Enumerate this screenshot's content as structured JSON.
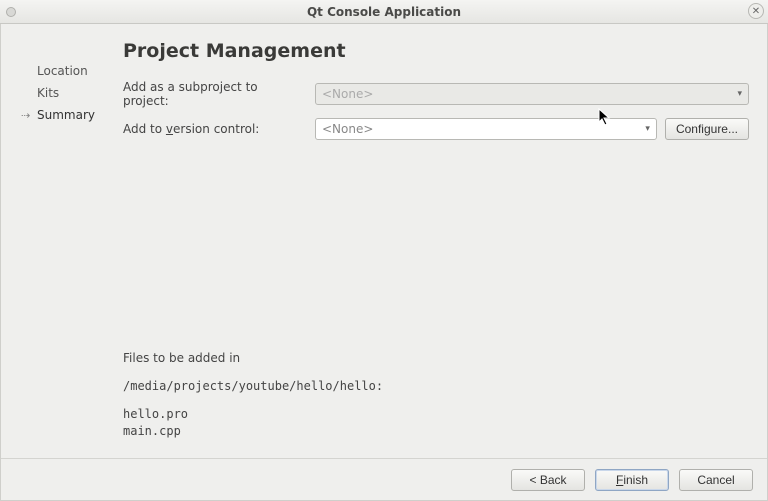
{
  "window": {
    "title": "Qt Console Application"
  },
  "sidebar": {
    "items": [
      {
        "label": "Location",
        "active": false
      },
      {
        "label": "Kits",
        "active": false
      },
      {
        "label": "Summary",
        "active": true
      }
    ]
  },
  "page": {
    "title": "Project Management",
    "subproject_label_pre": "Add as a subproject to project:",
    "subproject_value": "<None>",
    "vcs_label_pre": "Add to ",
    "vcs_label_underline": "v",
    "vcs_label_post": "ersion control:",
    "vcs_value": "<None>",
    "configure_label": "Configure...",
    "files_heading": "Files to be added in",
    "files_path": "/media/projects/youtube/hello/hello:",
    "files_list": "hello.pro\nmain.cpp"
  },
  "footer": {
    "back_label": "< Back",
    "finish_pre": "",
    "finish_underline": "F",
    "finish_post": "inish",
    "cancel_label": "Cancel"
  }
}
